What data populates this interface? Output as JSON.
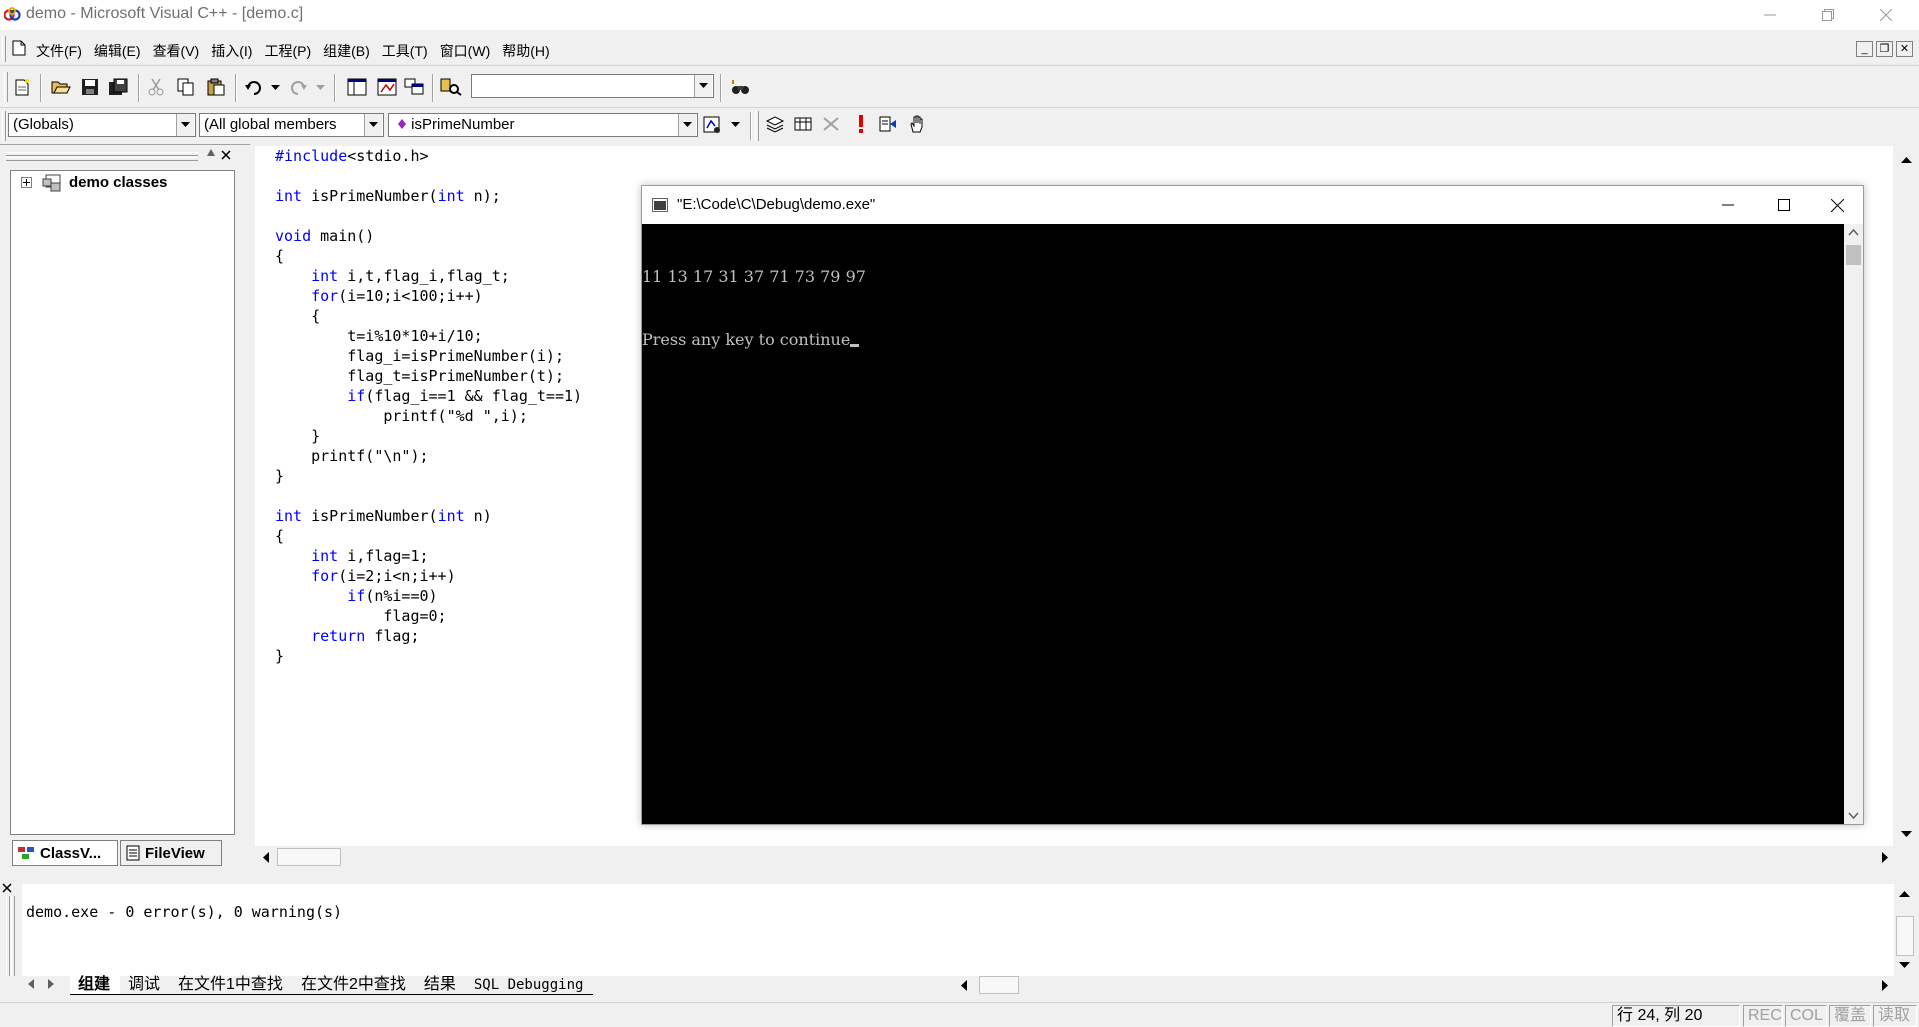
{
  "window": {
    "title": "demo - Microsoft Visual C++ - [demo.c]"
  },
  "menu": {
    "items": [
      "文件(F)",
      "编辑(E)",
      "查看(V)",
      "插入(I)",
      "工程(P)",
      "组建(B)",
      "工具(T)",
      "窗口(W)",
      "帮助(H)"
    ]
  },
  "toolbar": {
    "find_combo_value": ""
  },
  "wizardbar": {
    "scope": "(Globals)",
    "filter": "(All global members",
    "member": "isPrimeNumber"
  },
  "workspace": {
    "tree_root": "demo classes",
    "tabs": [
      "ClassV...",
      "FileView"
    ]
  },
  "editor": {
    "filename": "demo.c",
    "lines": [
      "#include<stdio.h>",
      "",
      "int isPrimeNumber(int n);",
      "",
      "void main()",
      "{",
      "    int i,t,flag_i,flag_t;",
      "    for(i=10;i<100;i++)",
      "    {",
      "        t=i%10*10+i/10;",
      "        flag_i=isPrimeNumber(i);",
      "        flag_t=isPrimeNumber(t);",
      "        if(flag_i==1 && flag_t==1)",
      "            printf(\"%d \",i);",
      "    }",
      "    printf(\"\\n\");",
      "}",
      "",
      "int isPrimeNumber(int n)",
      "{",
      "    int i,flag=1;",
      "    for(i=2;i<n;i++)",
      "        if(n%i==0)",
      "            flag=0;",
      "    return flag;",
      "}"
    ]
  },
  "console": {
    "title": "\"E:\\Code\\C\\Debug\\demo.exe\"",
    "line1": "11 13 17 31 37 71 73 79 97",
    "line2": "Press any key to continue"
  },
  "output": {
    "message": "demo.exe - 0 error(s), 0 warning(s)",
    "tabs": [
      "组建",
      "调试",
      "在文件1中查找",
      "在文件2中查找",
      "结果",
      "SQL Debugging"
    ]
  },
  "statusbar": {
    "position": "行 24, 列 20",
    "rec": "REC",
    "col": "COL",
    "ovr": "覆盖",
    "read": "读取"
  }
}
